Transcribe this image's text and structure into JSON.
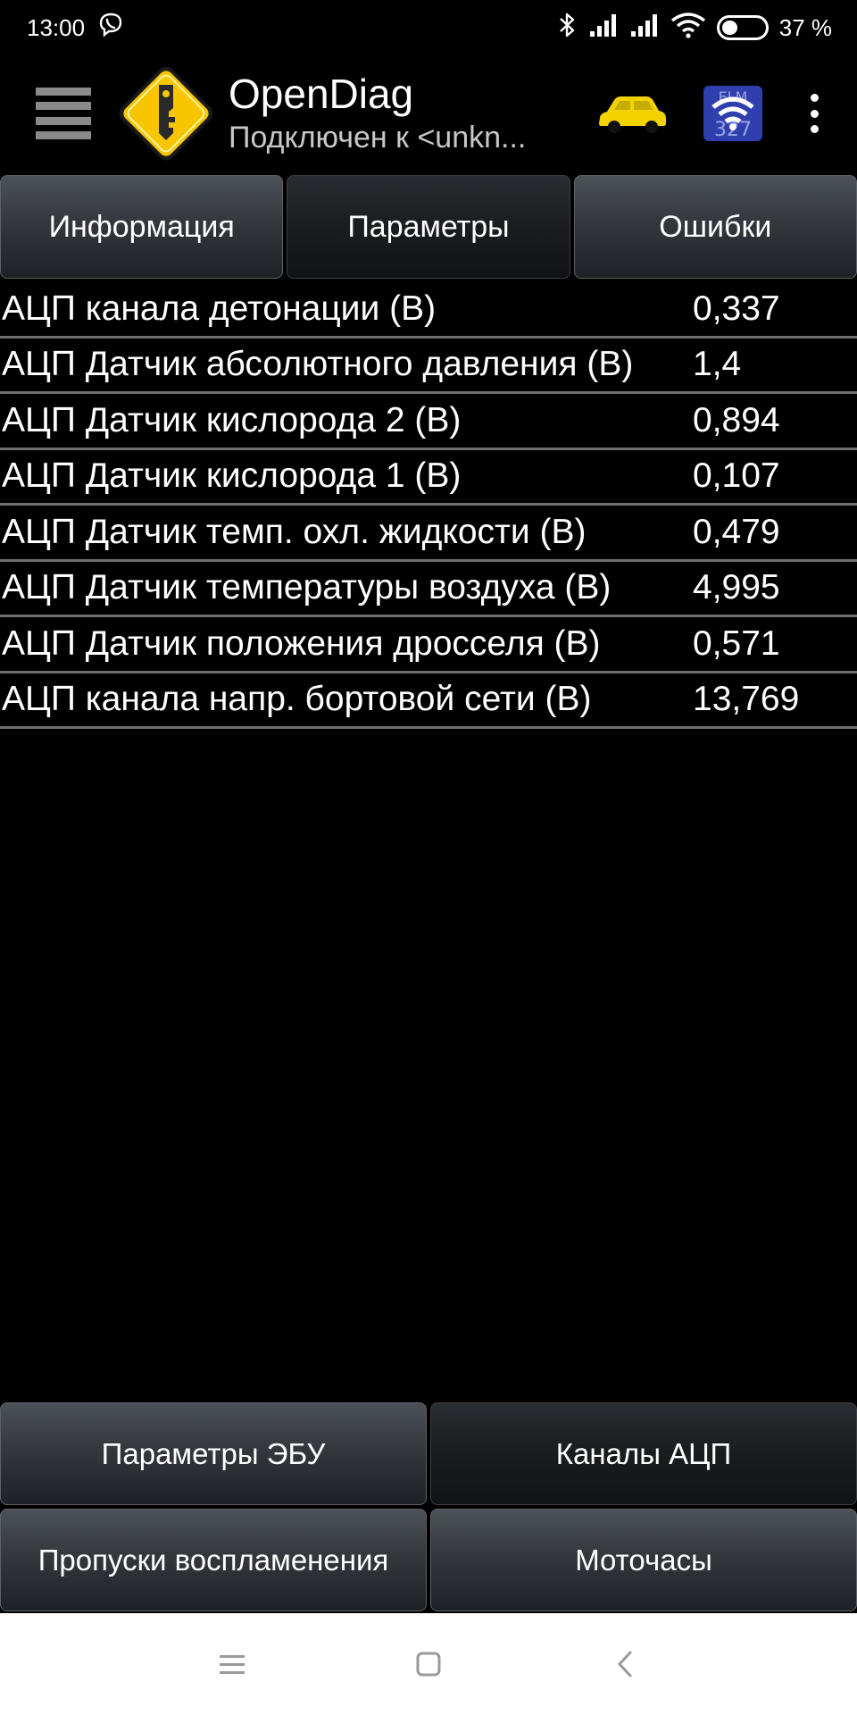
{
  "status_bar": {
    "time": "13:00",
    "battery_percent": "37 %",
    "battery_level": 0.37,
    "icons": [
      "viber-icon",
      "bluetooth-icon",
      "signal-1-icon",
      "signal-2-icon",
      "wifi-icon",
      "battery-icon"
    ]
  },
  "app_bar": {
    "title": "OpenDiag",
    "subtitle": "Подключен к <unkn...",
    "icons": [
      "menu-icon",
      "app-logo-key-icon",
      "car-icon",
      "elm327-wifi-icon",
      "overflow-menu-icon"
    ]
  },
  "tabs": [
    {
      "label": "Информация",
      "active": false
    },
    {
      "label": "Параметры",
      "active": true
    },
    {
      "label": "Ошибки",
      "active": false
    }
  ],
  "params": [
    {
      "name": "АЦП канала детонации (В)",
      "value": "0,337"
    },
    {
      "name": "АЦП Датчик абсолютного давления (В)",
      "value": "1,4"
    },
    {
      "name": "АЦП Датчик кислорода 2 (В)",
      "value": "0,894"
    },
    {
      "name": "АЦП Датчик кислорода 1 (В)",
      "value": "0,107"
    },
    {
      "name": "АЦП Датчик темп. охл. жидкости (В)",
      "value": "0,479"
    },
    {
      "name": "АЦП Датчик температуры воздуха (В)",
      "value": "4,995"
    },
    {
      "name": "АЦП Датчик положения дросселя (В)",
      "value": "0,571"
    },
    {
      "name": "АЦП канала напр. бортовой сети (В)",
      "value": "13,769"
    }
  ],
  "bottom_buttons": [
    {
      "label": "Параметры ЭБУ",
      "active": false
    },
    {
      "label": "Каналы АЦП",
      "active": true
    },
    {
      "label": "Пропуски воспламенения",
      "active": false
    },
    {
      "label": "Моточасы",
      "active": false
    }
  ],
  "nav_bar": {
    "icons": [
      "nav-menu-icon",
      "nav-home-icon",
      "nav-back-icon"
    ]
  },
  "colors": {
    "background": "#000000",
    "car_yellow": "#f2d200",
    "logo_yellow": "#f7c600",
    "elm_blue": "#2f3fae",
    "divider": "#6f6f6f"
  }
}
